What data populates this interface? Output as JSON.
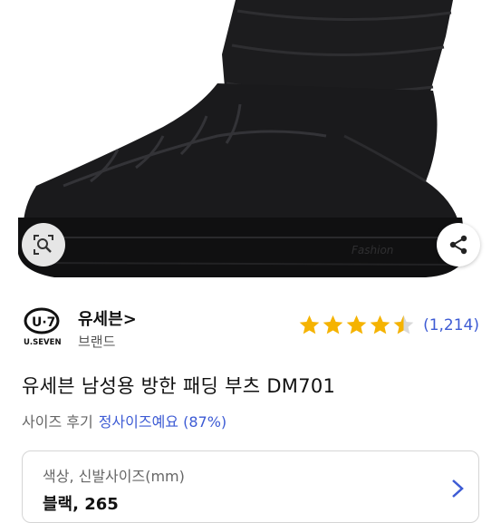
{
  "hero": {
    "zoom_icon": "magnifier-icon",
    "share_icon": "share-icon",
    "sole_text": "Fashion"
  },
  "brand": {
    "logo_text_top": "U·7",
    "logo_text_bottom": "U.SEVEN",
    "name": "유세븐",
    "chevron": ">",
    "sublabel": "브랜드"
  },
  "rating": {
    "stars": 4.5,
    "count": "(1,214)",
    "star_color": "#f5b301",
    "count_color": "#3d5bd4"
  },
  "product": {
    "title": "유세븐 남성용 방한 패딩 부츠 DM701"
  },
  "review": {
    "label": "사이즈 후기",
    "value": "정사이즈예요 (87%)"
  },
  "option": {
    "label": "색상, 신발사이즈(mm)",
    "value": "블랙, 265",
    "chevron_icon": "chevron-right-icon"
  }
}
